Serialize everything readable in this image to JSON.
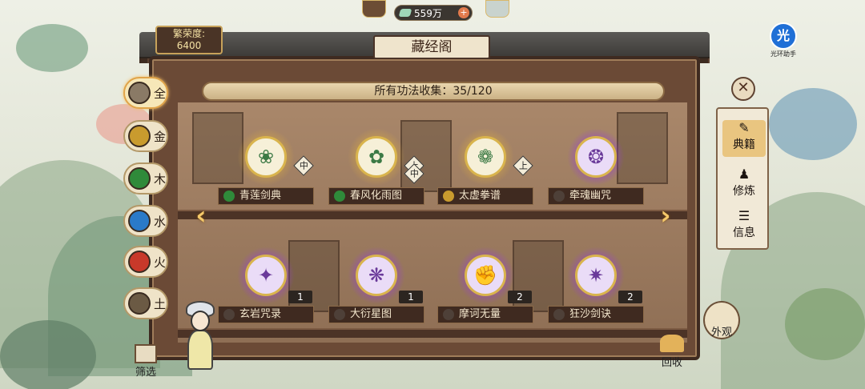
{
  "header": {
    "currency_amount": "559万",
    "currency_plus": "+",
    "prosperity_label": "繁荣度:",
    "prosperity_value": "6400",
    "helper_glyph": "光",
    "helper_caption": "光环助手",
    "title": "藏经阁"
  },
  "collection_banner": "所有功法收集：35/120",
  "element_tabs": [
    {
      "label": "全",
      "icon": "all-elements-icon",
      "color": "#8a7a66",
      "active": true
    },
    {
      "label": "金",
      "icon": "metal-icon",
      "color": "#c99b2e",
      "active": false
    },
    {
      "label": "木",
      "icon": "wood-icon",
      "color": "#2f8a3a",
      "active": false
    },
    {
      "label": "水",
      "icon": "water-icon",
      "color": "#2a7ac9",
      "active": false
    },
    {
      "label": "火",
      "icon": "fire-icon",
      "color": "#c8392a",
      "active": false
    },
    {
      "label": "土",
      "icon": "earth-icon",
      "color": "#6b5a44",
      "active": false
    }
  ],
  "filter_label": "筛选",
  "skills_row1": [
    {
      "name": "青莲剑典",
      "element": "wood",
      "grade": "中",
      "glyph": "❀"
    },
    {
      "name": "春风化雨图",
      "element": "wood",
      "grade": "上",
      "grade2": "中",
      "glyph": "✿"
    },
    {
      "name": "太虚拳谱",
      "element": "metal",
      "grade": "上",
      "glyph": "❁"
    },
    {
      "name": "牵魂幽咒",
      "element": "earth",
      "glyph": "❂"
    }
  ],
  "skills_row2": [
    {
      "name": "玄岩咒录",
      "element": "earth",
      "count": "1",
      "glyph": "✦"
    },
    {
      "name": "大衍星图",
      "element": "earth",
      "count": "1",
      "glyph": "❋"
    },
    {
      "name": "摩诃无量",
      "element": "earth",
      "count": "2",
      "glyph": "✊"
    },
    {
      "name": "狂沙剑诀",
      "element": "earth",
      "count": "2",
      "glyph": "✷"
    }
  ],
  "sidebar": {
    "close": "✕",
    "tabs": [
      {
        "label": "典籍",
        "active": true,
        "icon": "book-icon"
      },
      {
        "label": "修炼",
        "active": false,
        "icon": "meditate-icon"
      },
      {
        "label": "信息",
        "active": false,
        "icon": "scroll-icon"
      }
    ],
    "appearance": "外观",
    "recycle": "回收"
  },
  "colors": {
    "wood": "#2f8a3a",
    "metal": "#c99b2e",
    "earth": "#4e4038",
    "gold_frame": "#d9b44d",
    "purple_glow": "#a64dd8"
  }
}
